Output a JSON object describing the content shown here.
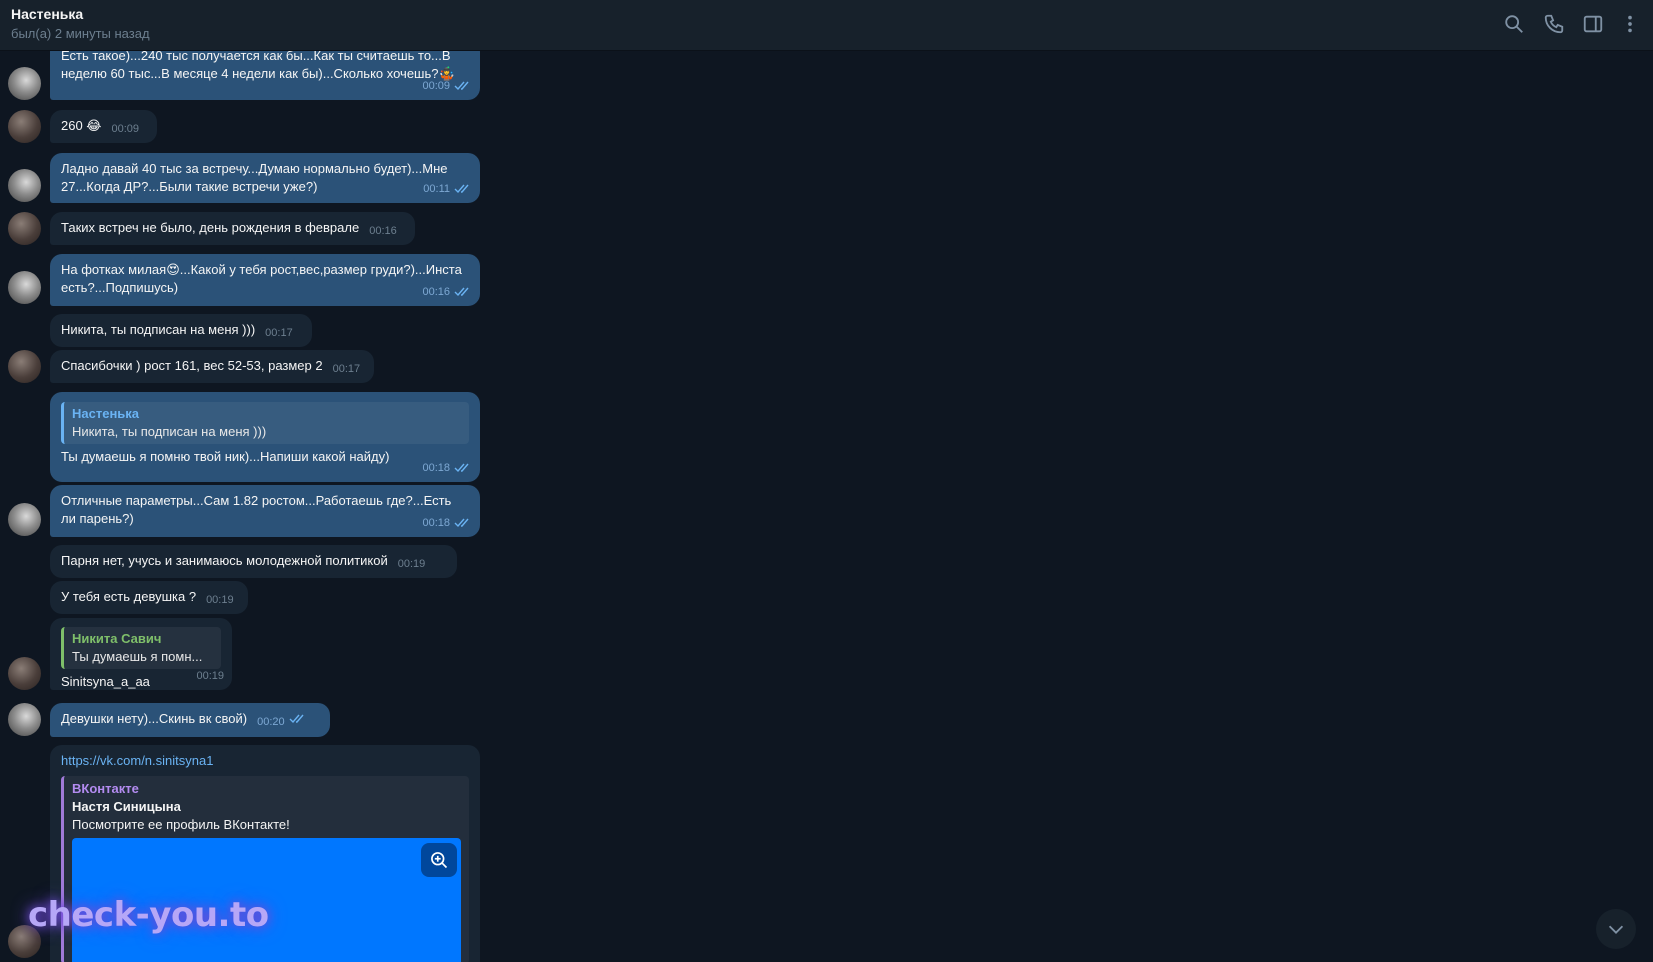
{
  "header": {
    "contact_name": "Настенька",
    "status": "был(а) 2 минуты назад",
    "icons": [
      "search-icon",
      "phone-icon",
      "sidebar-toggle-icon",
      "more-vertical-icon"
    ]
  },
  "messages": [
    {
      "dir": "out",
      "text": "Есть такое)...240 тыс получается как бы...Как ты считаешь то...В неделю 60 тыс...В месяце 4 недели как бы)...Сколько хочешь?🤹",
      "time": "00:09",
      "read": true
    },
    {
      "dir": "in",
      "text": "260 😂",
      "time": "00:09"
    },
    {
      "dir": "out",
      "text": "Ладно давай 40 тыс за встречу...Думаю нормально будет)...Мне 27...Когда ДР?...Были такие встречи уже?)",
      "time": "00:11",
      "read": true
    },
    {
      "dir": "in",
      "text": "Таких встреч не было, день рождения в феврале",
      "time": "00:16"
    },
    {
      "dir": "out",
      "text": "На фотках милая😍...Какой у тебя рост,вес,размер груди?)...Инста есть?...Подпишусь)",
      "time": "00:16",
      "read": true
    },
    {
      "dir": "in",
      "text": "Никита, ты подписан на меня )))",
      "time": "00:17"
    },
    {
      "dir": "in",
      "text": "Спасибочки ) рост 161, вес 52-53, размер 2",
      "time": "00:17"
    },
    {
      "dir": "out",
      "reply_name": "Настенька",
      "reply_text": "Никита, ты подписан на меня )))",
      "text": "Ты думаешь я помню твой ник)...Напиши какой найду)",
      "time": "00:18",
      "read": true
    },
    {
      "dir": "out",
      "text": "Отличные параметры...Сам 1.82 ростом...Работаешь где?...Есть ли парень?)",
      "time": "00:18",
      "read": true
    },
    {
      "dir": "in",
      "text": "Парня нет, учусь и занимаюсь молодежной политикой",
      "time": "00:19"
    },
    {
      "dir": "in",
      "text": "У тебя есть девушка ?",
      "time": "00:19"
    },
    {
      "dir": "in",
      "reply_name": "Никита Савич",
      "reply_text": "Ты думаешь я помн...",
      "text": "Sinitsyna_a_aa",
      "time": "00:19"
    },
    {
      "dir": "out",
      "text": "Девушки нету)...Скинь вк свой)",
      "time": "00:20",
      "read": true
    },
    {
      "dir": "in",
      "link": "https://vk.com/n.sinitsyna1",
      "preview": {
        "site": "ВКонтакте",
        "title": "Настя Синицына",
        "description": "Посмотрите ее профиль ВКонтакте!"
      }
    }
  ],
  "watermark": "check-you.to",
  "colors": {
    "background": "#0e1621",
    "outgoing": "#2b5278",
    "incoming": "#182533",
    "accent": "#6ab3f3"
  }
}
